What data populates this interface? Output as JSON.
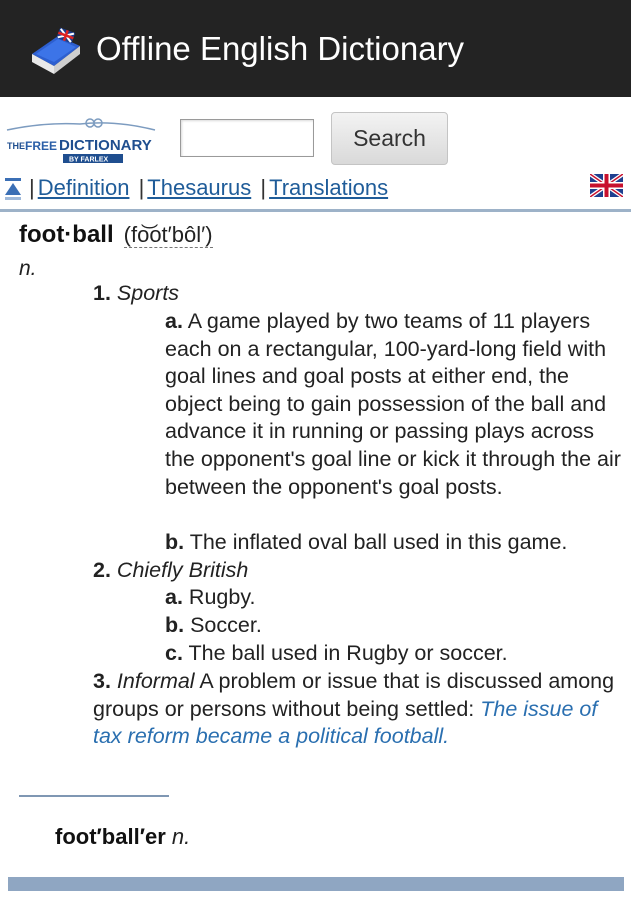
{
  "app": {
    "title": "Offline English Dictionary",
    "icon": "book-icon"
  },
  "search": {
    "logo_text_the": "THE",
    "logo_text_free": "FREE",
    "logo_text_dictionary": "DICTIONARY",
    "logo_text_by": "BY FARLEX",
    "input_value": "",
    "input_placeholder": "",
    "button_label": "Search"
  },
  "nav": {
    "links": [
      "Definition",
      "Thesaurus",
      "Translations"
    ],
    "separator": "|",
    "flag_icon": "uk-flag-icon"
  },
  "entry": {
    "headword": "foot·ball",
    "pronunciation": "(fo͝ot′bôl′)",
    "pos": "n.",
    "sense1": {
      "number": "1.",
      "label": "Sports",
      "a_marker": "a.",
      "a_text": "A game played by two teams of 11 players each on a rectangular, 100-yard-long field with goal lines and goal posts at either end, the object being to gain possession of the ball and advance it in running or passing plays across the opponent's goal line or kick it through the air between the opponent's goal posts.",
      "b_marker": "b.",
      "b_text": "The inflated oval ball used in this game."
    },
    "sense2": {
      "number": "2.",
      "label": "Chiefly British",
      "a_marker": "a.",
      "a_text": "Rugby.",
      "b_marker": "b.",
      "b_text": "Soccer.",
      "c_marker": "c.",
      "c_text": "The ball used in Rugby or soccer."
    },
    "sense3": {
      "number": "3.",
      "label": "Informal",
      "text": "A problem or issue that is discussed among groups or persons without being settled:",
      "example": "The issue of tax reform became a political football."
    },
    "derived": {
      "word": "foot′ball′er",
      "pos": "n."
    }
  },
  "colors": {
    "actionbar": "#232323",
    "link": "#1f5c99",
    "example": "#2a6fb0",
    "rule": "#9db2c8"
  }
}
